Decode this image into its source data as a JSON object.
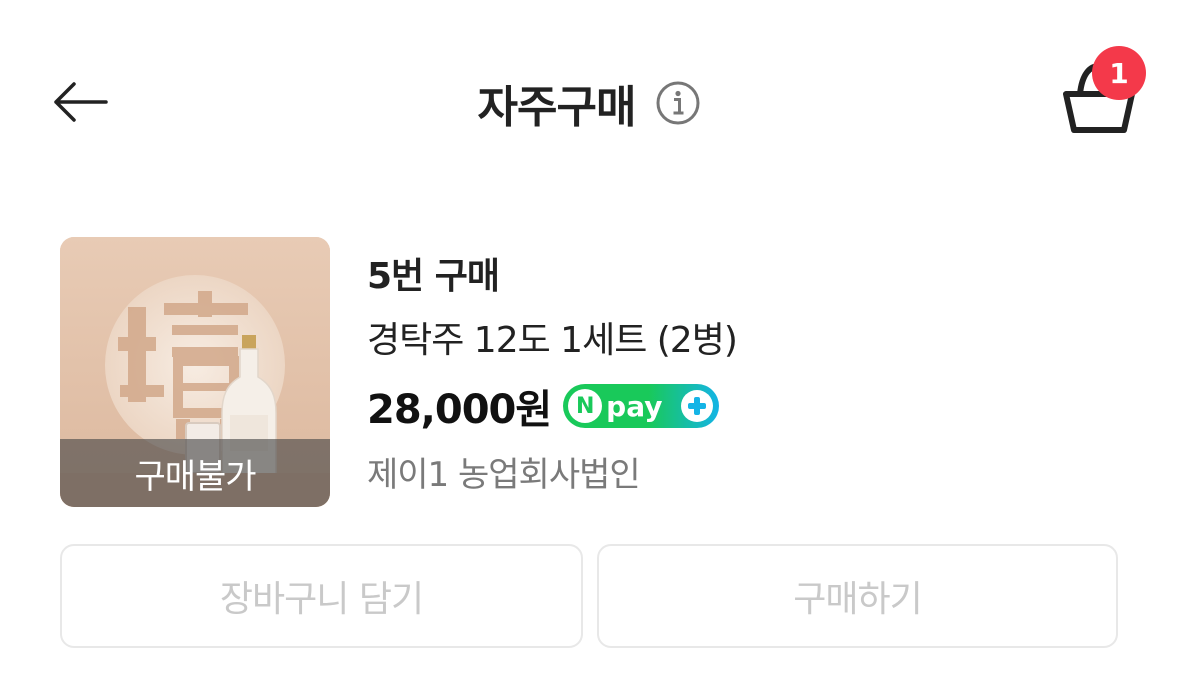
{
  "header": {
    "title": "자주구매",
    "cart_badge_count": "1",
    "icons": [
      "back-arrow-icon",
      "info-icon",
      "shopping-basket-icon"
    ]
  },
  "product": {
    "thumbnail_overlay": "구매불가",
    "purchase_count": "5번 구매",
    "name": "경탁주 12도 1세트 (2병)",
    "price": "28,000원",
    "npay_badge": {
      "text": "pay",
      "letter": "N",
      "colors": {
        "green": "#19c95a",
        "blue": "#14b4e6"
      }
    },
    "seller": "제이1 농업회사법인"
  },
  "actions": {
    "add_to_cart": "장바구니 담기",
    "buy": "구매하기"
  },
  "colors": {
    "badge_red": "#f4394a",
    "disabled_text": "#c9c9c9",
    "seller_gray": "#7a7a7a"
  }
}
